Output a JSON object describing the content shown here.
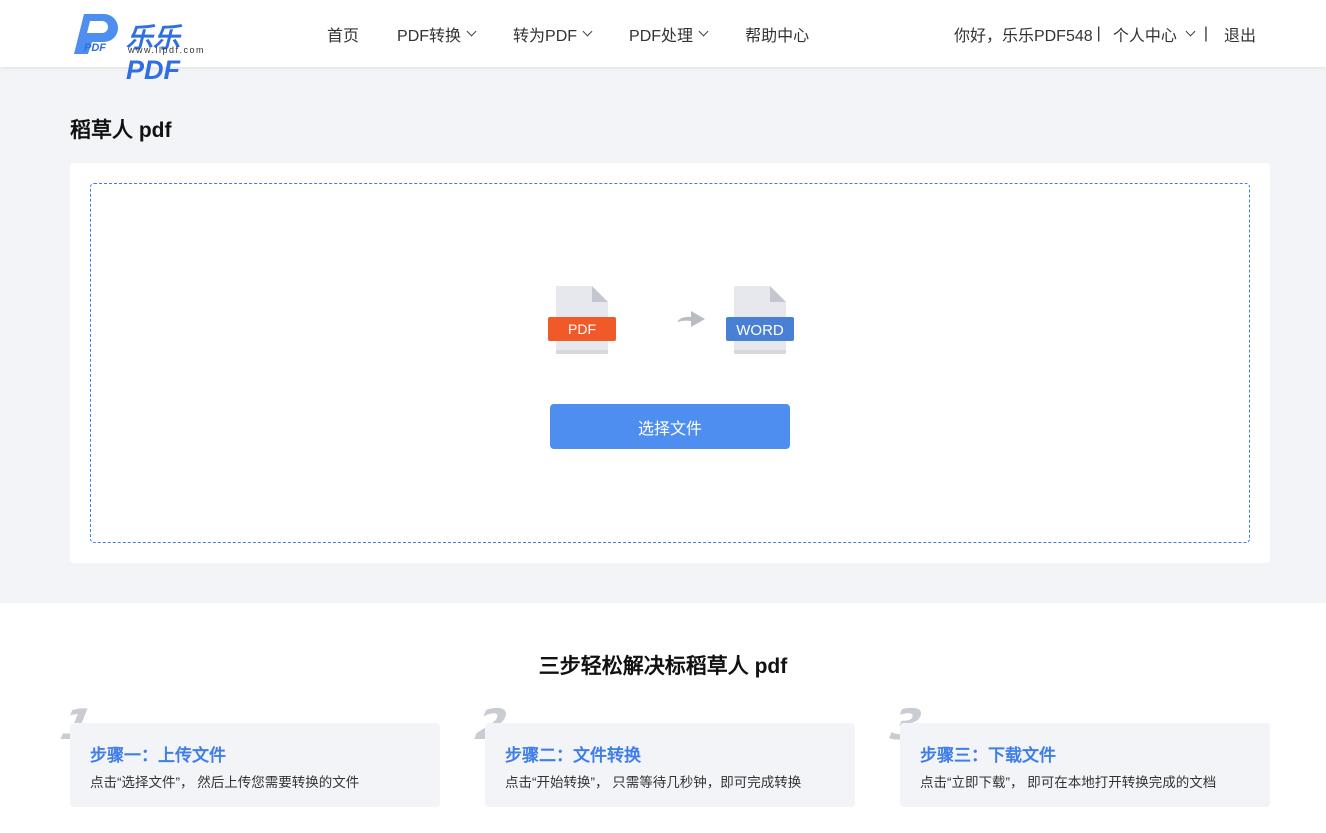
{
  "header": {
    "logo_text": "乐乐PDF",
    "logo_url": "www.llpdf.com",
    "nav": [
      {
        "label": "首页",
        "has_dropdown": false
      },
      {
        "label": "PDF转换",
        "has_dropdown": true
      },
      {
        "label": "转为PDF",
        "has_dropdown": true
      },
      {
        "label": "PDF处理",
        "has_dropdown": true
      },
      {
        "label": "帮助中心",
        "has_dropdown": false
      }
    ],
    "greeting": "你好，乐乐PDF548",
    "user_center": "个人中心",
    "logout": "退出"
  },
  "main": {
    "title": "稻草人 pdf",
    "from_format": "PDF",
    "to_format": "WORD",
    "select_button": "选择文件"
  },
  "steps": {
    "title": "三步轻松解决标稻草人 pdf",
    "items": [
      {
        "num": "1",
        "head": "步骤一：上传文件",
        "desc": "点击“选择文件”， 然后上传您需要转换的文件"
      },
      {
        "num": "2",
        "head": "步骤二：文件转换",
        "desc": "点击“开始转换”， 只需等待几秒钟，即可完成转换"
      },
      {
        "num": "3",
        "head": "步骤三：下载文件",
        "desc": "点击“立即下载”， 即可在本地打开转换完成的文档"
      }
    ]
  },
  "colors": {
    "accent": "#4d8ef0",
    "dashed_border": "#3f7ee8",
    "pdf_badge": "#f05a28",
    "word_badge": "#4a7fd6",
    "background": "#f3f4f7"
  }
}
